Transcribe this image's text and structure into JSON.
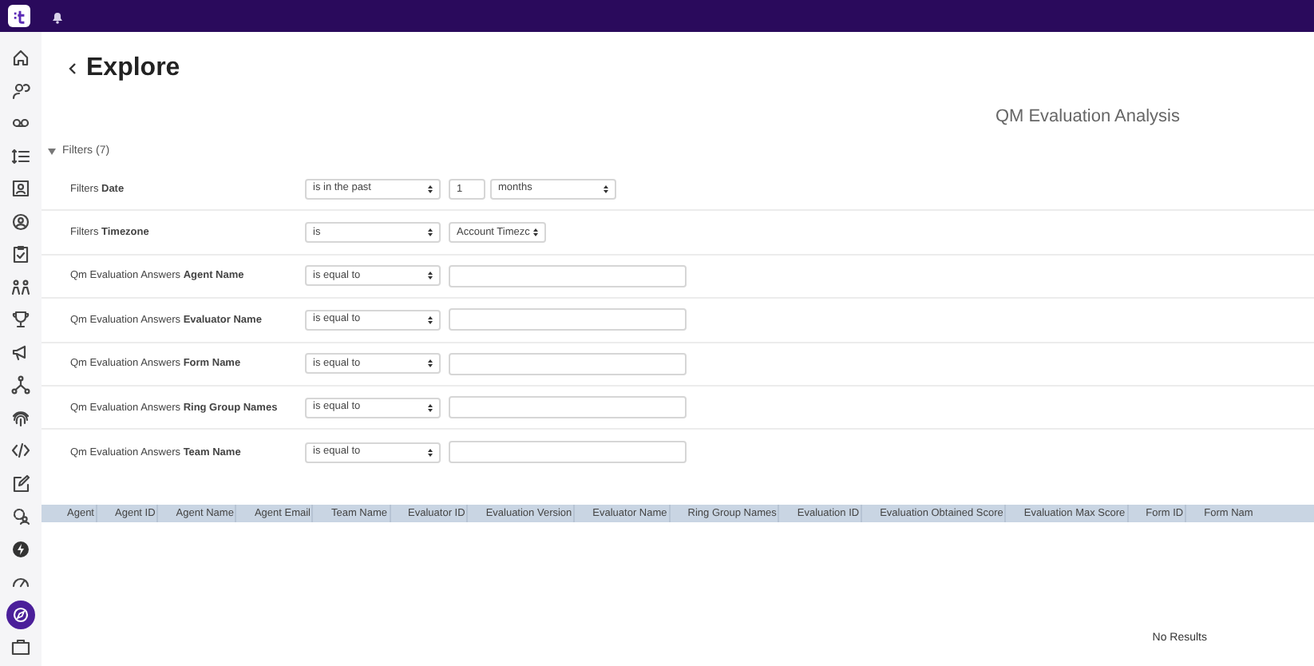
{
  "sidebar": {
    "items": [
      {
        "selected": false
      },
      {
        "selected": false
      },
      {
        "selected": false
      },
      {
        "selected": false
      },
      {
        "selected": false
      },
      {
        "selected": false
      },
      {
        "selected": false
      },
      {
        "selected": false
      },
      {
        "selected": false
      },
      {
        "selected": false
      },
      {
        "selected": false
      },
      {
        "selected": false
      },
      {
        "selected": false
      },
      {
        "selected": false
      },
      {
        "selected": false
      },
      {
        "selected": false
      },
      {
        "selected": false
      },
      {
        "selected": true
      },
      {
        "selected": false
      }
    ]
  },
  "header": {
    "title": "Explore",
    "subtitle": "QM Evaluation Analysis"
  },
  "filters": {
    "label": "Filters (7)",
    "expanded": true,
    "rows": [
      {
        "label": "Filters **Date**",
        "operator": "is in the past",
        "kind": "number_unit",
        "value": "1",
        "unit": "months"
      },
      {
        "label": "Filters **Timezone**",
        "operator": "is",
        "kind": "select",
        "value": "Account Timezc"
      },
      {
        "label": "Qm Evaluation Answers **Agent Name**",
        "operator": "is equal to",
        "kind": "text"
      },
      {
        "label": "Qm Evaluation Answers **Evaluator Name**",
        "operator": "is equal to",
        "kind": "text"
      },
      {
        "label": "Qm Evaluation Answers **Form Name**",
        "operator": "is equal to",
        "kind": "text"
      },
      {
        "label": "Qm Evaluation Answers **Ring Group Names**",
        "operator": "is equal to",
        "kind": "text"
      },
      {
        "label": "Qm Evaluation Answers **Team Name**",
        "operator": "is equal to",
        "kind": "text"
      }
    ]
  },
  "table": {
    "columns": [
      "Agent",
      "Agent ID",
      "Agent Name",
      "Agent Email",
      "Team Name",
      "Evaluator ID",
      "Evaluation Version",
      "Evaluator Name",
      "Ring Group Names",
      "Evaluation ID",
      "Evaluation Obtained Score",
      "Evaluation Max Score",
      "Form ID",
      "Form Nam"
    ],
    "empty_message": "No Results"
  }
}
